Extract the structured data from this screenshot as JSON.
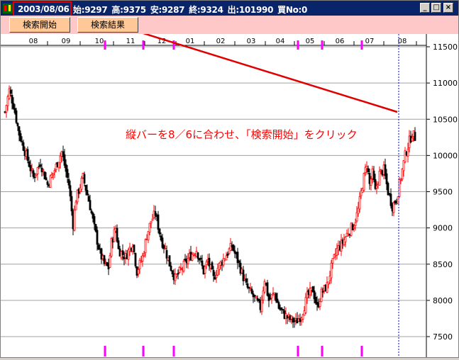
{
  "window": {
    "date": "2003/08/06",
    "stats": [
      "始:9297",
      "高:9375",
      "安:9287",
      "終:9324",
      "出:101990",
      "買No:0"
    ],
    "controls": [
      "_",
      "□",
      "×"
    ]
  },
  "toolbar": {
    "search_start_label": "検索開始",
    "search_result_label": "検索結果"
  },
  "annotation": "縦バーを8／6に合わせ、「検索開始」をクリック",
  "colors": {
    "title_bg": "#0a246a",
    "toolbar_bg": "#ffc8c8",
    "button_bg": "#ffc896",
    "up": "#ff0000",
    "down": "#000000",
    "marker": "#ff00ff",
    "cursor": "#0000ff",
    "annotation": "#ff0000"
  },
  "chart_data": {
    "type": "candlestick",
    "x_month_labels": [
      "08",
      "09",
      "10",
      "11",
      "12",
      "01",
      "02",
      "03",
      "04",
      "05",
      "06",
      "07",
      "08"
    ],
    "y_ticks": [
      11500,
      11000,
      10500,
      10000,
      9500,
      9000,
      8500,
      8000,
      7500
    ],
    "ylim": [
      7300,
      11600
    ],
    "grid": true,
    "trading_days": 262,
    "cursor_day": 258,
    "marker_days": [
      73,
      98,
      120,
      211,
      227,
      255
    ],
    "close_path": [
      [
        0,
        10600
      ],
      [
        3,
        10900
      ],
      [
        6,
        10700
      ],
      [
        10,
        10300
      ],
      [
        15,
        10000
      ],
      [
        20,
        9700
      ],
      [
        25,
        9900
      ],
      [
        30,
        9600
      ],
      [
        35,
        9800
      ],
      [
        40,
        10050
      ],
      [
        45,
        9600
      ],
      [
        48,
        9050
      ],
      [
        50,
        9400
      ],
      [
        55,
        9700
      ],
      [
        60,
        9300
      ],
      [
        63,
        9000
      ],
      [
        67,
        8650
      ],
      [
        70,
        8500
      ],
      [
        73,
        8450
      ],
      [
        75,
        8800
      ],
      [
        78,
        9000
      ],
      [
        80,
        8700
      ],
      [
        85,
        8600
      ],
      [
        90,
        8800
      ],
      [
        93,
        8400
      ],
      [
        97,
        8600
      ],
      [
        100,
        8900
      ],
      [
        103,
        9100
      ],
      [
        106,
        9200
      ],
      [
        110,
        8850
      ],
      [
        113,
        8700
      ],
      [
        116,
        8500
      ],
      [
        120,
        8300
      ],
      [
        125,
        8450
      ],
      [
        130,
        8600
      ],
      [
        135,
        8700
      ],
      [
        140,
        8400
      ],
      [
        143,
        8550
      ],
      [
        147,
        8300
      ],
      [
        150,
        8450
      ],
      [
        155,
        8600
      ],
      [
        160,
        8750
      ],
      [
        165,
        8500
      ],
      [
        170,
        8200
      ],
      [
        175,
        8050
      ],
      [
        180,
        7900
      ],
      [
        183,
        8300
      ],
      [
        186,
        8000
      ],
      [
        190,
        8100
      ],
      [
        193,
        7900
      ],
      [
        197,
        7800
      ],
      [
        200,
        7750
      ],
      [
        205,
        7700
      ],
      [
        209,
        7800
      ],
      [
        213,
        8050
      ],
      [
        217,
        8150
      ],
      [
        220,
        7900
      ],
      [
        223,
        8100
      ],
      [
        227,
        8200
      ],
      [
        230,
        8450
      ],
      [
        234,
        8700
      ],
      [
        238,
        8800
      ],
      [
        242,
        8950
      ],
      [
        246,
        9050
      ],
      [
        249,
        9250
      ],
      [
        252,
        9600
      ],
      [
        255,
        9900
      ],
      [
        257,
        9600
      ],
      [
        259,
        9750
      ],
      [
        261,
        9500
      ],
      [
        264,
        9750
      ],
      [
        267,
        9800
      ],
      [
        270,
        9500
      ],
      [
        273,
        9300
      ],
      [
        276,
        9400
      ],
      [
        279,
        9700
      ],
      [
        282,
        10000
      ],
      [
        285,
        10200
      ],
      [
        287,
        10300
      ],
      [
        289,
        10250
      ]
    ],
    "trend_line": [
      [
        22,
        11550
      ],
      [
        258,
        10580
      ]
    ]
  }
}
